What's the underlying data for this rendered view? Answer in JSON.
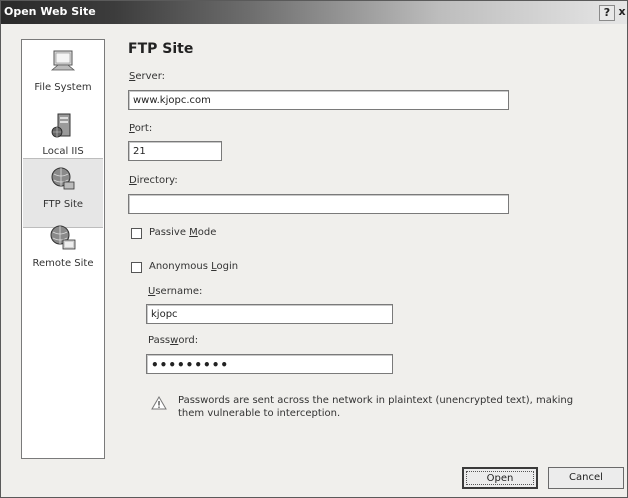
{
  "window": {
    "title": "Open Web Site",
    "help": "?",
    "close": "x"
  },
  "sidebar": {
    "items": [
      {
        "label": "File System",
        "icon": "file-system-icon"
      },
      {
        "label": "Local IIS",
        "icon": "local-iis-icon"
      },
      {
        "label": "FTP Site",
        "icon": "ftp-site-icon",
        "selected": true
      },
      {
        "label": "Remote Site",
        "icon": "remote-site-icon"
      }
    ]
  },
  "panel": {
    "title": "FTP Site",
    "server_label": {
      "accel": "S",
      "rest": "erver:"
    },
    "server_value": "www.kjopc.com",
    "port_label": {
      "accel": "P",
      "rest": "ort:"
    },
    "port_value": "21",
    "directory_label": {
      "accel": "D",
      "rest": "irectory:"
    },
    "directory_value": "",
    "passive_label": {
      "pre": "Passive ",
      "accel": "M",
      "rest": "ode"
    },
    "passive_checked": false,
    "anonymous_label": {
      "pre": "Anonymous ",
      "accel": "L",
      "rest": "ogin"
    },
    "anonymous_checked": false,
    "username_label": {
      "accel": "U",
      "rest": "sername:"
    },
    "username_value": "kjopc",
    "password_label": {
      "pre": "Pass",
      "accel": "w",
      "rest": "ord:"
    },
    "password_value": "•••••••••",
    "warning": "Passwords are sent across the network in plaintext (unencrypted text), making them vulnerable to interception."
  },
  "buttons": {
    "open": "Open",
    "cancel": "Cancel"
  },
  "colors": {
    "titlebar_dark": "#2a2a2a",
    "selected_item": "#e6e6e6",
    "warning_triangle": "#777777"
  }
}
